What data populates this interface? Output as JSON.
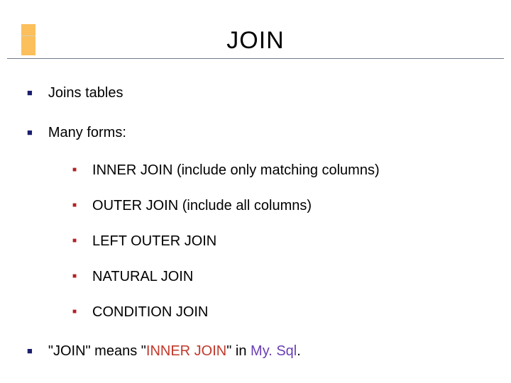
{
  "title": "JOIN",
  "bullets": [
    {
      "text": "Joins tables"
    },
    {
      "text": "Many forms:",
      "sub": [
        "INNER JOIN (include only matching columns)",
        "OUTER JOIN (include all columns)",
        "LEFT OUTER JOIN",
        "NATURAL JOIN",
        "CONDITION JOIN"
      ]
    }
  ],
  "footnote": {
    "q1": "\"JOIN\"",
    "mid": " means ",
    "q2_open": "\"",
    "q2_red": "INNER JOIN",
    "q2_close": "\"",
    "in": " in ",
    "mysql": "My. Sql",
    "dot": "."
  }
}
